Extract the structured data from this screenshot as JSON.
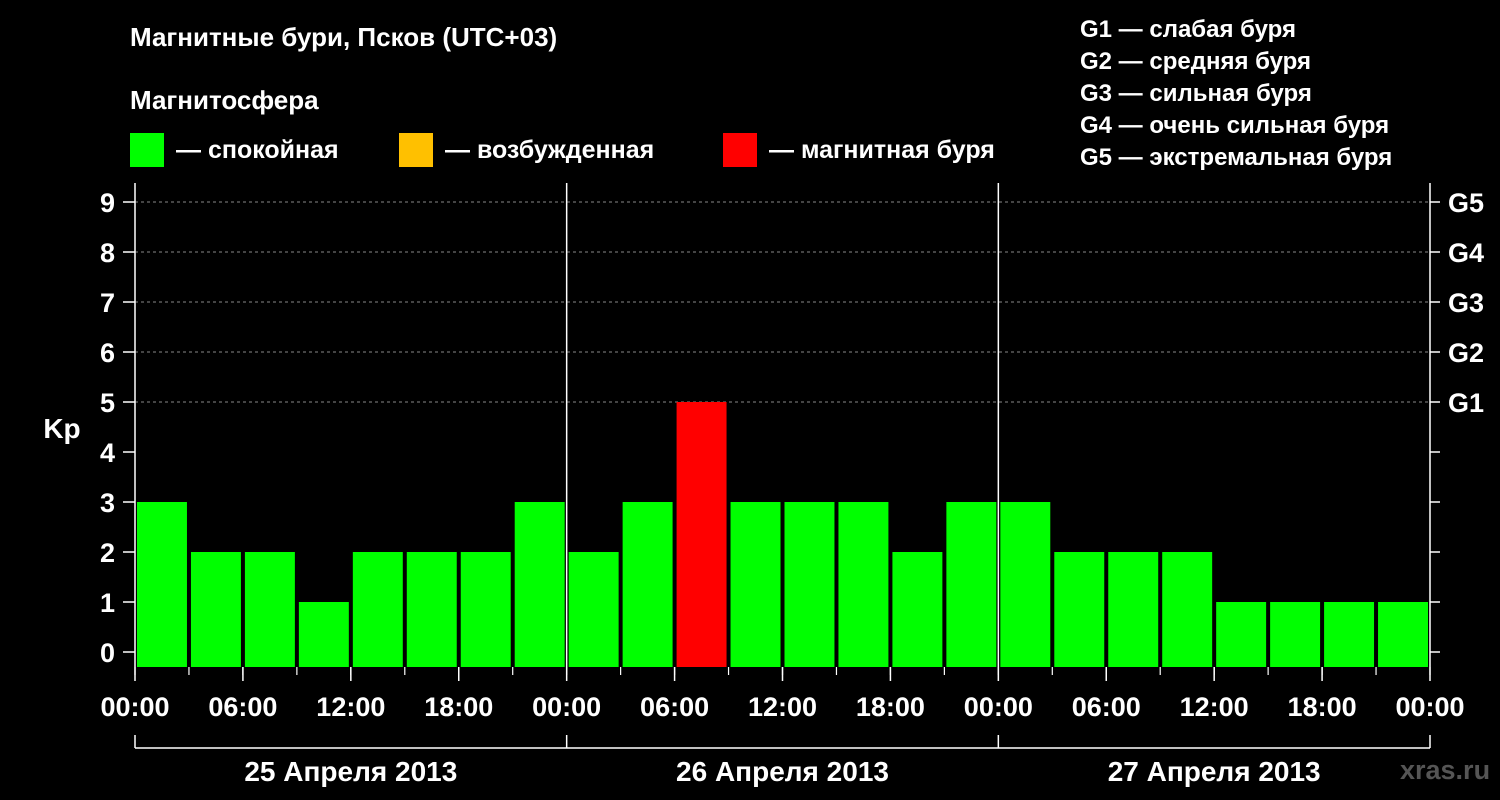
{
  "chart_data": {
    "type": "bar",
    "title": "Магнитные бури, Псков (UTC+03)",
    "subtitle": "Магнитосфера",
    "ylabel": "Kp",
    "ylim": [
      0,
      9
    ],
    "yticks": [
      "0",
      "1",
      "2",
      "3",
      "4",
      "5",
      "6",
      "7",
      "8",
      "9"
    ],
    "g_ticks": [
      {
        "kp": 5,
        "label": "G1"
      },
      {
        "kp": 6,
        "label": "G2"
      },
      {
        "kp": 7,
        "label": "G3"
      },
      {
        "kp": 8,
        "label": "G4"
      },
      {
        "kp": 9,
        "label": "G5"
      }
    ],
    "x_tick_labels": [
      "00:00",
      "06:00",
      "12:00",
      "18:00",
      "00:00",
      "06:00",
      "12:00",
      "18:00",
      "00:00",
      "06:00",
      "12:00",
      "18:00",
      "00:00"
    ],
    "days": [
      "25 Апреля 2013",
      "26 Апреля 2013",
      "27 Апреля 2013"
    ],
    "interval_hours": 3,
    "values": [
      3,
      2,
      2,
      1,
      2,
      2,
      2,
      3,
      2,
      3,
      5,
      3,
      3,
      3,
      2,
      3,
      3,
      2,
      2,
      2,
      1,
      1,
      1,
      1
    ],
    "status_levels": {
      "quiet": {
        "label": "— спокойная",
        "color": "#00ff00"
      },
      "disturbed": {
        "label": "— возбужденная",
        "color": "#ffc000"
      },
      "storm": {
        "label": "— магнитная буря",
        "color": "#ff0000"
      }
    },
    "status": [
      "quiet",
      "quiet",
      "quiet",
      "quiet",
      "quiet",
      "quiet",
      "quiet",
      "quiet",
      "quiet",
      "quiet",
      "storm",
      "quiet",
      "quiet",
      "quiet",
      "quiet",
      "quiet",
      "quiet",
      "quiet",
      "quiet",
      "quiet",
      "quiet",
      "quiet",
      "quiet",
      "quiet"
    ],
    "grid": true,
    "legend_placement": "top"
  },
  "g_legend": [
    "G1 — слабая буря",
    "G2 — средняя буря",
    "G3 — сильная буря",
    "G4 — очень сильная буря",
    "G5 — экстремальная буря"
  ],
  "watermark": "xras.ru"
}
